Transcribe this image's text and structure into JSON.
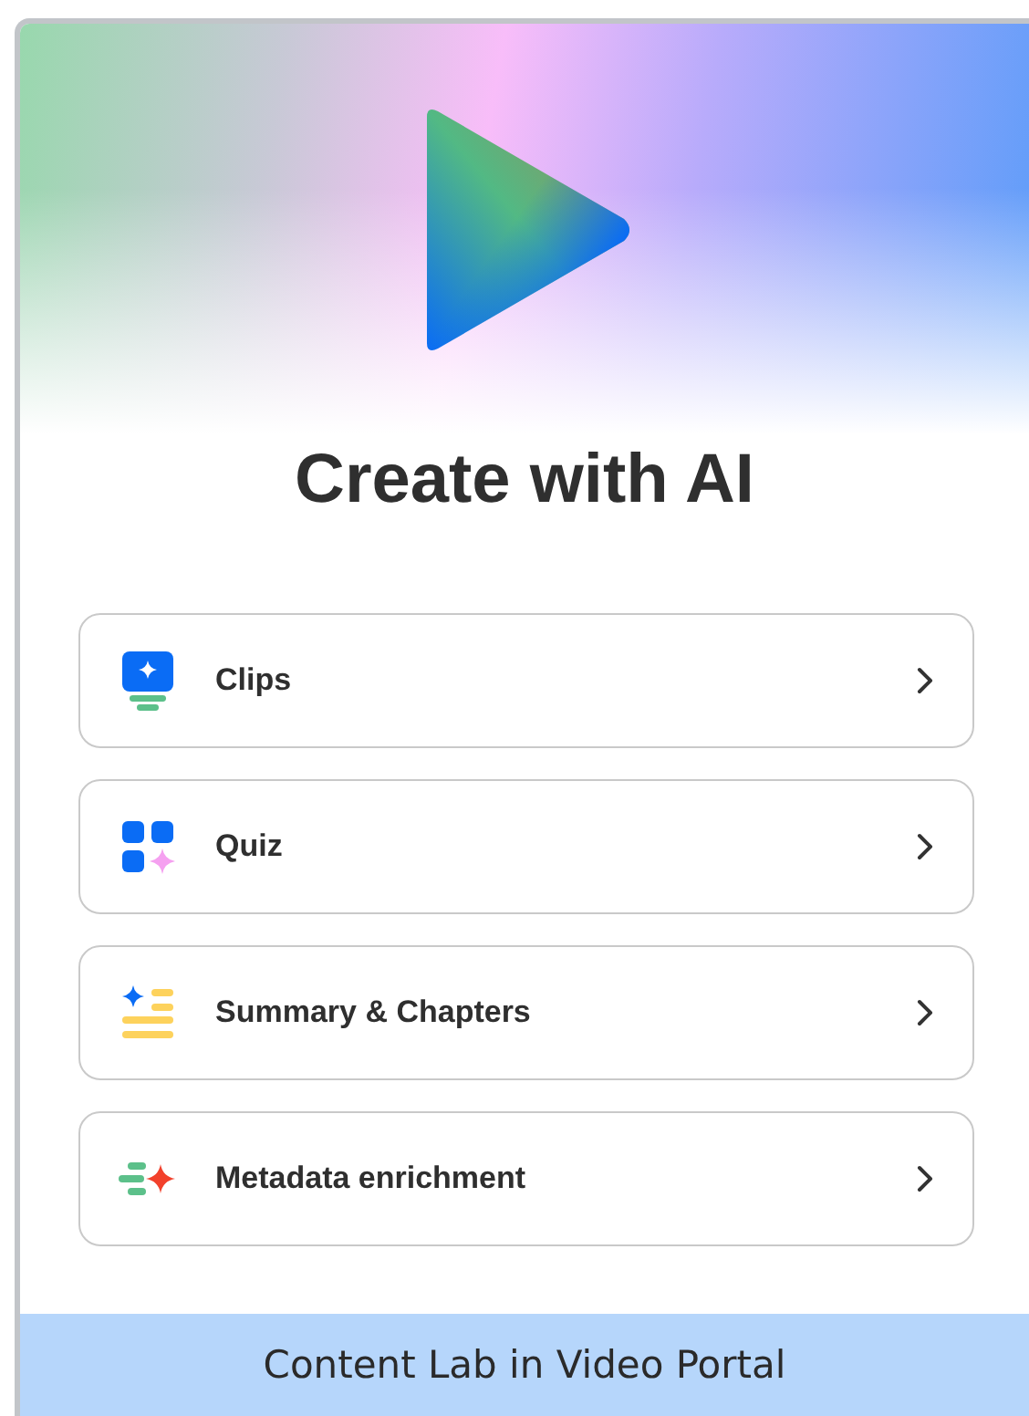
{
  "title": "Create with AI",
  "actions": [
    {
      "kind": "clips",
      "label": "Clips"
    },
    {
      "kind": "quiz",
      "label": "Quiz"
    },
    {
      "kind": "summary",
      "label": "Summary & Chapters"
    },
    {
      "kind": "metadata",
      "label": "Metadata enrichment"
    }
  ],
  "footer": "Content Lab in Video Portal"
}
